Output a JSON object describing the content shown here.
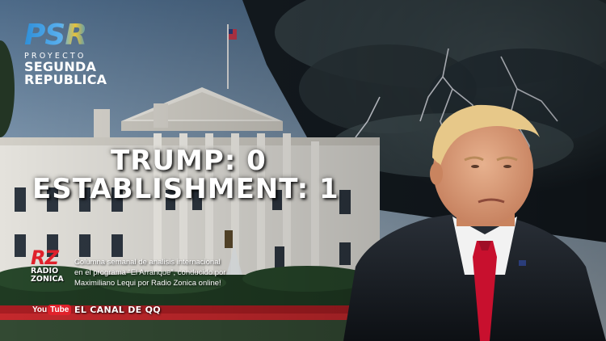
{
  "logo": {
    "mark": "PSR",
    "line1": "PROYECTO",
    "line2": "SEGUNDA",
    "line3": "REPUBLICA"
  },
  "headline": {
    "line1": "TRUMP: 0",
    "line2": "ESTABLISHMENT: 1"
  },
  "radio": {
    "badge": "RZ",
    "name_line1": "RADIO",
    "name_line2": "ZONICA"
  },
  "description": {
    "line1": "Columna semanal de analisis internacional",
    "line2": "en el programa “El Arranque”, conducido por",
    "line3": "Maximiliano Lequi por Radio Zonica online!"
  },
  "youtube": {
    "you": "You",
    "tube": "Tube",
    "channel": "EL CANAL DE QQ"
  },
  "colors": {
    "accent_red": "#e0212b",
    "text": "#ffffff",
    "logo_blue": "#2f8fd8"
  }
}
